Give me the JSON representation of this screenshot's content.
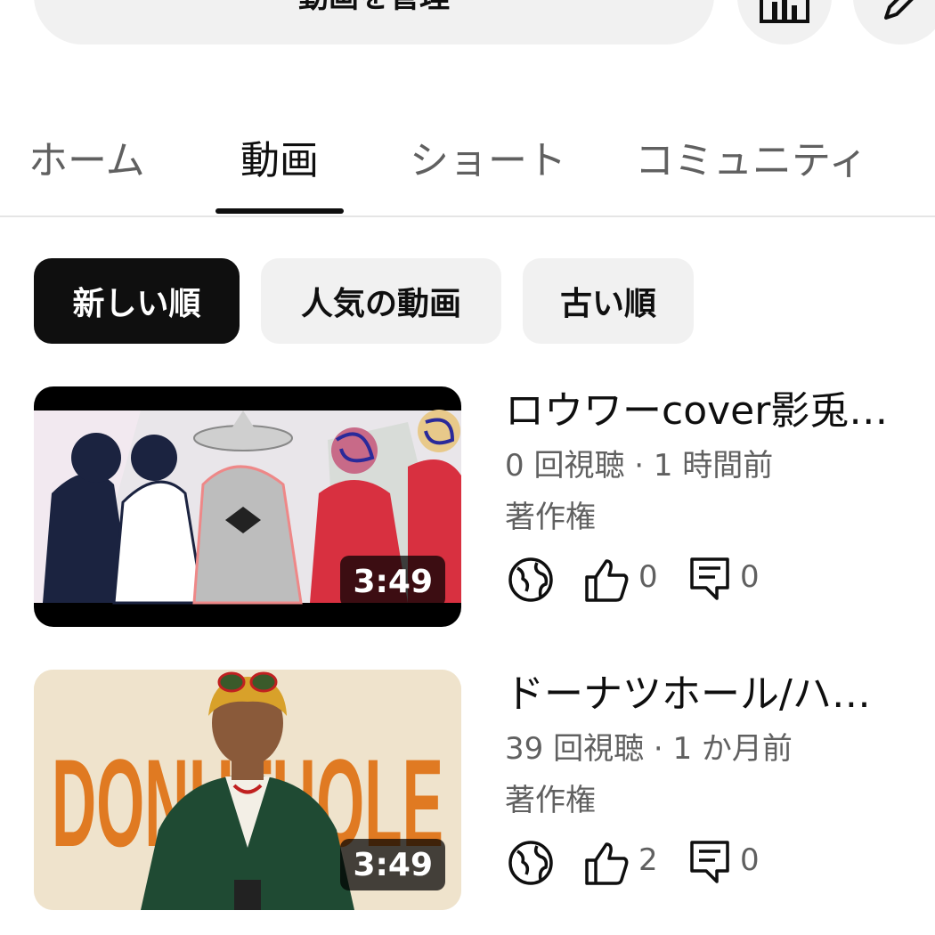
{
  "header": {
    "manage_label": "動画を管理",
    "analytics_icon": "bar-chart-icon",
    "edit_icon": "pencil-icon"
  },
  "tabs": [
    {
      "label": "ホーム",
      "active": false
    },
    {
      "label": "動画",
      "active": true
    },
    {
      "label": "ショート",
      "active": false
    },
    {
      "label": "コミュニティ",
      "active": false
    }
  ],
  "chips": [
    {
      "label": "新しい順",
      "selected": true
    },
    {
      "label": "人気の動画",
      "selected": false
    },
    {
      "label": "古い順",
      "selected": false
    }
  ],
  "videos": [
    {
      "title": "ロウワーcover影兎…",
      "views_time": "0 回視聴 · 1 時間前",
      "rights": "著作権",
      "duration": "3:49",
      "likes": "0",
      "comments": "0"
    },
    {
      "title": "ドーナツホール/ハ…",
      "views_time": "39 回視聴 · 1 か月前",
      "rights": "著作権",
      "duration": "3:49",
      "likes": "2",
      "comments": "0",
      "thumb_text": "DONUTHOLE"
    }
  ],
  "colors": {
    "chip_selected_bg": "#0f0f0f",
    "chip_bg": "#f1f1f1",
    "secondary_text": "#606060"
  }
}
